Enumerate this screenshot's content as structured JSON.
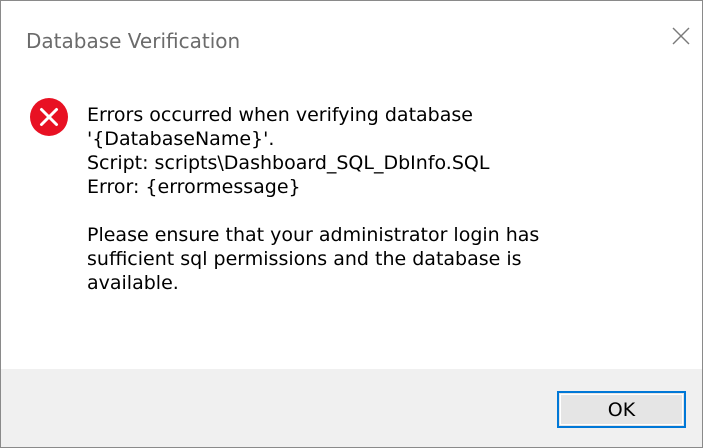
{
  "dialog": {
    "title": "Database Verification",
    "icon": "error-icon",
    "message_lines": [
      "Errors occurred when verifying database",
      "'{DatabaseName}'.",
      "Script: scripts\\Dashboard_SQL_DbInfo.SQL",
      "Error: {errormessage}"
    ],
    "note_lines": [
      "Please ensure that your administrator login has",
      "sufficient sql permissions and the database is",
      "available."
    ],
    "ok_label": "OK"
  },
  "colors": {
    "error_red": "#e81123",
    "button_border": "#0078d7",
    "footer_bg": "#f0f0f0"
  }
}
